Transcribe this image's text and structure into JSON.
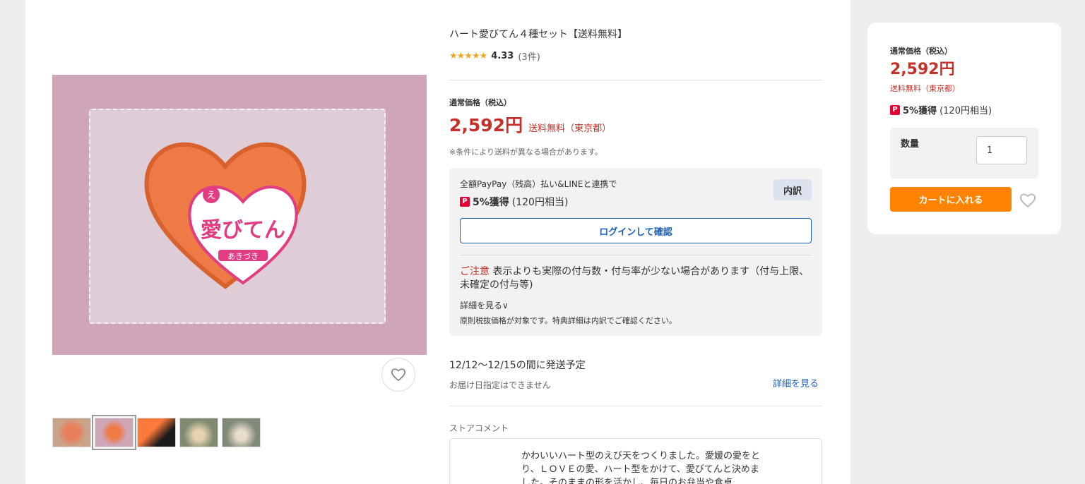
{
  "product": {
    "title": "ハート愛びてん４種セット【送料無料】",
    "rating_stars": "★★★★★",
    "rating_value": "4.33",
    "rating_count": "(3件)"
  },
  "price": {
    "label": "通常価格（税込）",
    "amount": "2,592円",
    "shipping": "送料無料（東京都）",
    "note": "※条件により送料が異なる場合があります。"
  },
  "paypay": {
    "line1": "全額PayPay（残高）払い&LINEと連携で",
    "icon": "P",
    "earn": "5%獲得",
    "equiv": "(120円相当)",
    "breakdown": "内訳",
    "login": "ログインして確認",
    "caution_prefix": "ご注意",
    "caution_text": " 表示よりも実際の付与数・付与率が少ない場合があります（付与上限、未確定の付与等)",
    "detail_link": "詳細を見る∨",
    "tax_note": "原則税抜価格が対象です。特典詳細は内訳でご確認ください。"
  },
  "delivery": {
    "date": "12/12～12/15の間に発送予定",
    "no_date": "お届け日指定はできません",
    "detail": "詳細を見る"
  },
  "store_comment": {
    "label": "ストアコメント",
    "text": "かわいいハート型のえび天をつくりました。愛媛の愛をとり、ＬＯＶＥの愛、ハート型をかけて、愛びてんと決めました。そのままの形を活かし、毎日のお弁当や食卓"
  },
  "image_text": {
    "top": "え",
    "main": "愛びてん",
    "sub": "あきづき"
  },
  "side": {
    "label": "通常価格（税込）",
    "price": "2,592円",
    "shipping": "送料無料（東京都）",
    "earn": "5%獲得",
    "equiv": "(120円相当)",
    "qty_label": "数量",
    "qty_value": "1",
    "cart": "カートに入れる"
  },
  "colors": {
    "price_red": "#c4312b",
    "cart_orange": "#ff8200",
    "link_blue": "#1a5fb4",
    "star": "#f5a623"
  }
}
